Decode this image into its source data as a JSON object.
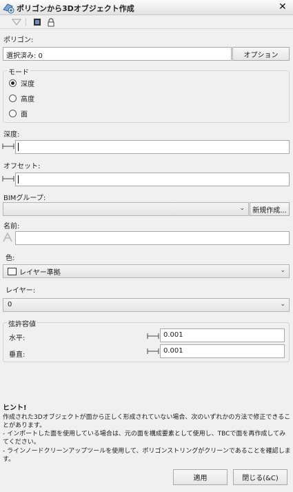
{
  "window": {
    "title": "ポリゴンから3Dオブジェクト作成",
    "close_symbol": "✕"
  },
  "toolbar": {
    "icons": [
      "filter-icon",
      "layer-view-icon",
      "lock-icon"
    ]
  },
  "polygon": {
    "label": "ポリゴン:",
    "value": "選択済み: 0",
    "options_button": "オプション"
  },
  "mode": {
    "group_label": "モード",
    "options": [
      {
        "label": "深度",
        "selected": true
      },
      {
        "label": "高度",
        "selected": false
      },
      {
        "label": "面",
        "selected": false
      }
    ]
  },
  "depth": {
    "label": "深度:",
    "value": ""
  },
  "offset": {
    "label": "オフセット:",
    "value": ""
  },
  "bim_group": {
    "label": "BIMグループ:",
    "value": "",
    "new_button": "新規作成..."
  },
  "name": {
    "label": "名前:",
    "value": ""
  },
  "color": {
    "label": "色:",
    "value": "レイヤー準拠",
    "swatch": "#ffffff"
  },
  "layer": {
    "label": "レイヤー:",
    "value": "0"
  },
  "tolerance": {
    "group_label": "弦許容値",
    "horizontal_label": "水平:",
    "horizontal_value": "0.001",
    "vertical_label": "垂直:",
    "vertical_value": "0.001"
  },
  "hint": {
    "title": "ヒント!",
    "line1": "作成された3Dオブジェクトが面から正しく形成されていない場合、次のいずれかの方法で修正できることがあります。",
    "line2": "- インポートした面を使用している場合は、元の面を構成要素として使用し、TBCで面を再作成してみてください。",
    "line3": "- ラインノードクリーンアップツールを使用して、ポリゴンストリングがクリーンであることを確認します。"
  },
  "footer": {
    "apply_button": "適用",
    "close_button": "閉じる(&C)"
  }
}
